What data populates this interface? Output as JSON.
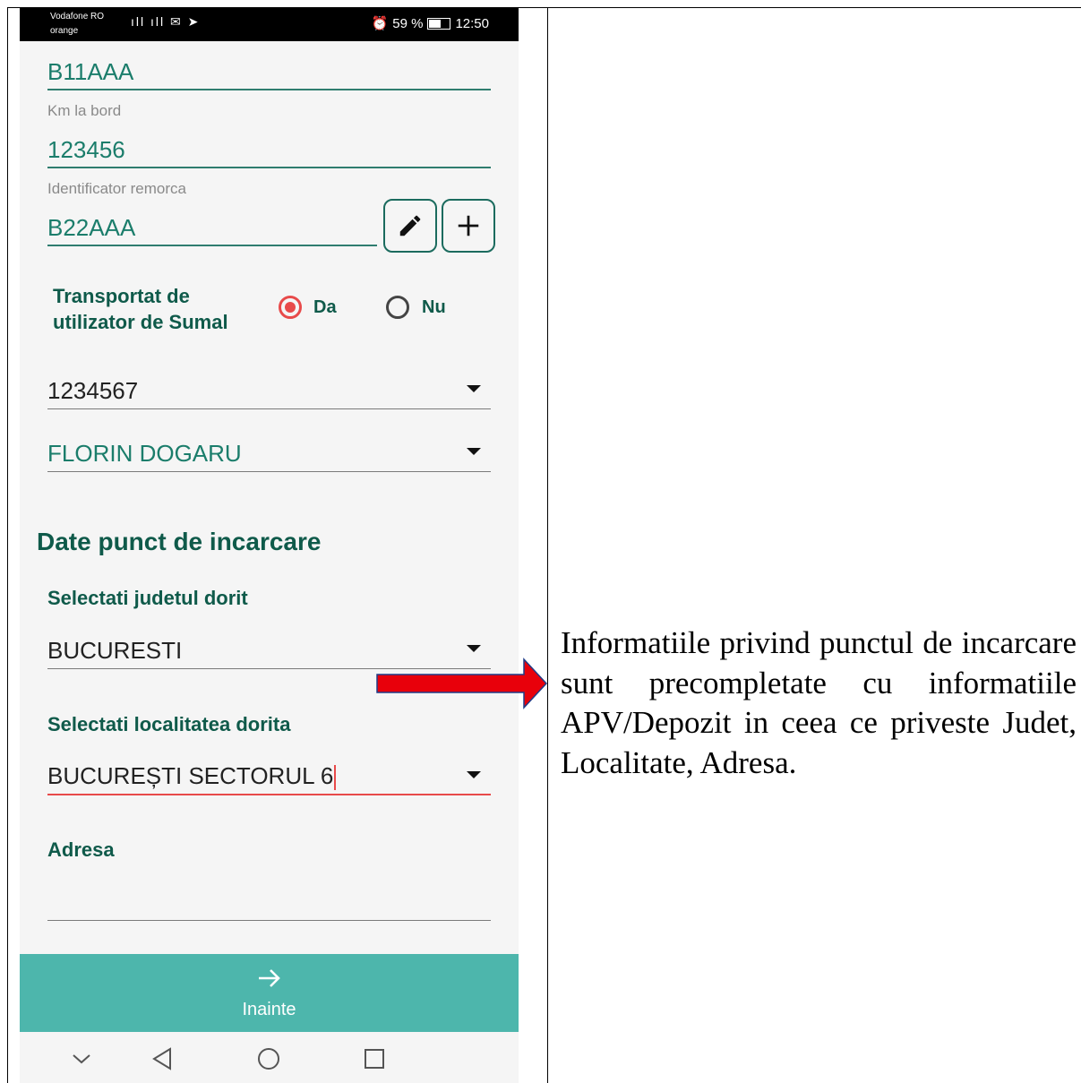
{
  "status_bar": {
    "carrier_primary": "Vodafone RO",
    "carrier_secondary": "orange",
    "network_icons": "4G+ .ıll .ıll",
    "battery_percent": "59 %",
    "time": "12:50"
  },
  "form": {
    "vehicle_id_value": "B11AAA",
    "km_label": "Km la bord",
    "km_value": "123456",
    "trailer_label": "Identificator remorca",
    "trailer_value": "B22AAA",
    "transport_question": "Transportat de utilizator de Sumal",
    "transport_question_line1": "Transportat de",
    "transport_question_line2": "utilizator de Sumal",
    "radio_yes_label": "Da",
    "radio_no_label": "Nu",
    "radio_selected": "Da",
    "code_dropdown_value": "1234567",
    "driver_dropdown_value": "FLORIN DOGARU",
    "section_title": "Date punct de incarcare",
    "county_label": "Selectati judetul dorit",
    "county_value": "BUCURESTI",
    "locality_label": "Selectati localitatea dorita",
    "locality_value": "BUCUREȘTI SECTORUL 6",
    "address_label": "Adresa",
    "address_value": ""
  },
  "next_button": {
    "label": "Inainte"
  },
  "annotation": {
    "text": "Informatiile privind punctul de incarcare sunt precompletate cu informatiile APV/Depozit in ceea ce priveste Judet, Localitate, Adresa.",
    "arrow_color": "#e8000b"
  },
  "icons": [
    "pencil-icon",
    "plus-icon",
    "arrow-right-icon",
    "chevron-down-icon",
    "back-triangle-icon",
    "home-circle-icon",
    "recents-square-icon"
  ]
}
